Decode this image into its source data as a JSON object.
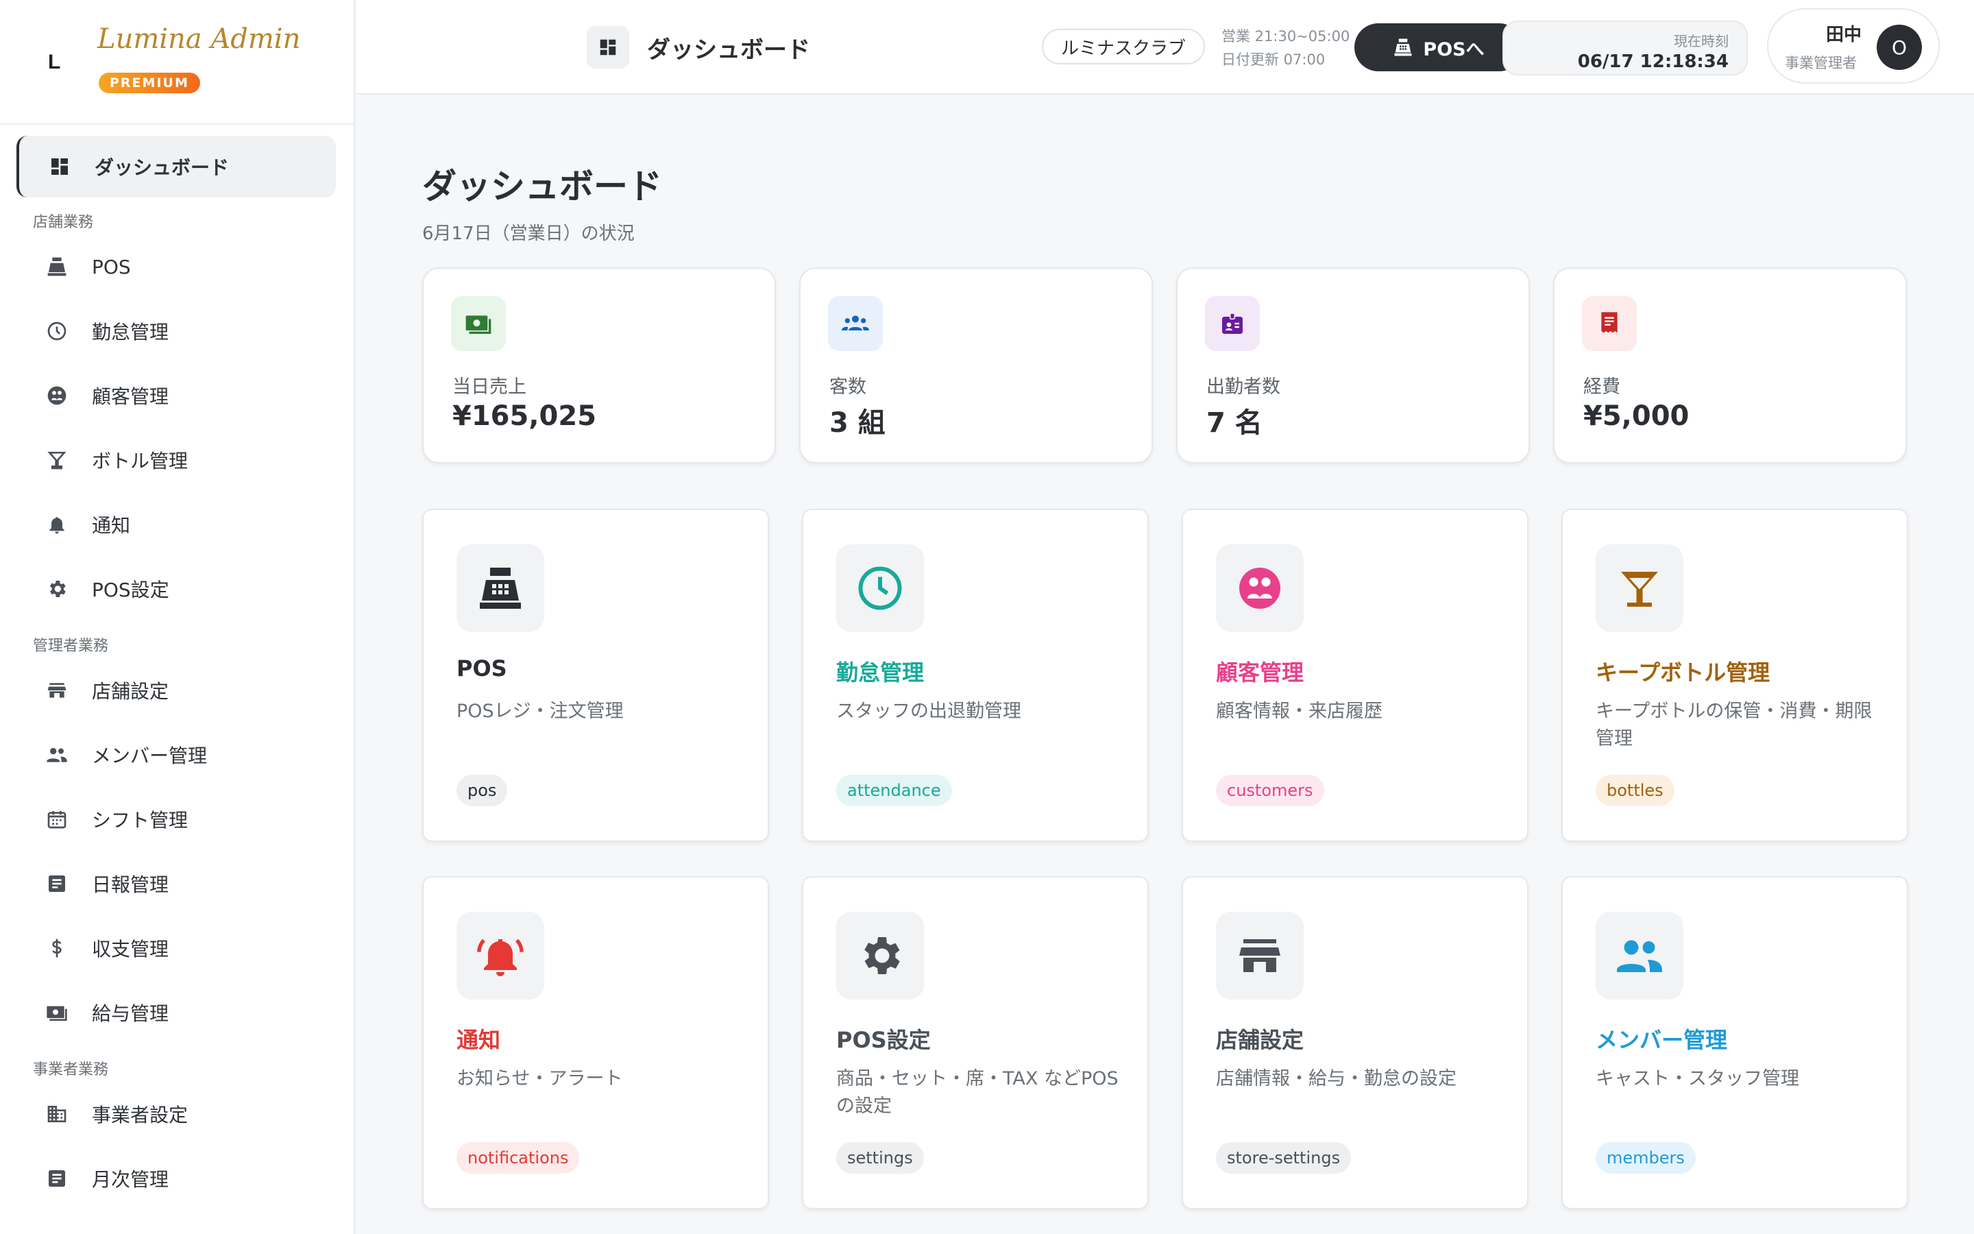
{
  "brand": {
    "mark": "L",
    "name": "Lumina Admin",
    "badge": "PREMIUM"
  },
  "sidebar": {
    "active": {
      "label": "ダッシュボード"
    },
    "sections": [
      {
        "title": "店舗業務",
        "items": [
          {
            "label": "POS"
          },
          {
            "label": "勤怠管理"
          },
          {
            "label": "顧客管理"
          },
          {
            "label": "ボトル管理"
          },
          {
            "label": "通知"
          },
          {
            "label": "POS設定"
          }
        ]
      },
      {
        "title": "管理者業務",
        "items": [
          {
            "label": "店舗設定"
          },
          {
            "label": "メンバー管理"
          },
          {
            "label": "シフト管理"
          },
          {
            "label": "日報管理"
          },
          {
            "label": "収支管理"
          },
          {
            "label": "給与管理"
          }
        ]
      },
      {
        "title": "事業者業務",
        "items": [
          {
            "label": "事業者設定"
          },
          {
            "label": "月次管理"
          }
        ]
      }
    ]
  },
  "topbar": {
    "title": "ダッシュボード",
    "store": "ルミナスクラブ",
    "hours": "営業 21:30~05:00",
    "date_update": "日付更新 07:00",
    "pos_button": "POSへ",
    "clock_label": "現在時刻",
    "clock_value": "06/17 12:18:34",
    "user_name": "田中",
    "user_role": "事業管理者",
    "avatar": "O"
  },
  "page": {
    "title": "ダッシュボード",
    "subtitle": "6月17日（営業日）の状況"
  },
  "stats": [
    {
      "label": "当日売上",
      "value": "¥165,025",
      "color": "#2e7d32",
      "bg": "#e8f5e9",
      "icon": "cash-icon"
    },
    {
      "label": "客数",
      "value": "3 組",
      "color": "#1565c0",
      "bg": "#e8f0fb",
      "icon": "group-icon"
    },
    {
      "label": "出勤者数",
      "value": "7 名",
      "color": "#6a1b9a",
      "bg": "#f3e8f8",
      "icon": "badge-icon"
    },
    {
      "label": "経費",
      "value": "¥5,000",
      "color": "#c62828",
      "bg": "#fdeaea",
      "icon": "receipt-icon"
    }
  ],
  "cards": [
    {
      "title": "POS",
      "desc": "POSレジ・注文管理",
      "tag": "pos",
      "color": "#2b2f33",
      "tag_bg": "#eeeff1",
      "tag_color": "#2b2f33",
      "icon": "register-icon"
    },
    {
      "title": "勤怠管理",
      "desc": "スタッフの出退勤管理",
      "tag": "attendance",
      "color": "#17a99a",
      "tag_bg": "#e3f6f3",
      "tag_color": "#17a99a",
      "icon": "clock-icon"
    },
    {
      "title": "顧客管理",
      "desc": "顧客情報・来店履歴",
      "tag": "customers",
      "color": "#e8408a",
      "tag_bg": "#fde8f1",
      "tag_color": "#e8408a",
      "icon": "customer-icon"
    },
    {
      "title": "キープボトル管理",
      "desc": "キープボトルの保管・消費・期限管理",
      "tag": "bottles",
      "color": "#a2620a",
      "tag_bg": "#fbf0e0",
      "tag_color": "#a2620a",
      "icon": "cocktail-icon"
    },
    {
      "title": "通知",
      "desc": "お知らせ・アラート",
      "tag": "notifications",
      "color": "#e53935",
      "tag_bg": "#fdeaea",
      "tag_color": "#e53935",
      "icon": "bell-icon"
    },
    {
      "title": "POS設定",
      "desc": "商品・セット・席・TAX などPOSの設定",
      "tag": "settings",
      "color": "#4a5056",
      "tag_bg": "#eeeff1",
      "tag_color": "#4a5056",
      "icon": "gear-icon"
    },
    {
      "title": "店舗設定",
      "desc": "店舗情報・給与・勤怠の設定",
      "tag": "store-settings",
      "color": "#4a5056",
      "tag_bg": "#eeeff1",
      "tag_color": "#4a5056",
      "icon": "store-icon"
    },
    {
      "title": "メンバー管理",
      "desc": "キャスト・スタッフ管理",
      "tag": "members",
      "color": "#1e9ad6",
      "tag_bg": "#e4f3fb",
      "tag_color": "#1e9ad6",
      "icon": "people-icon"
    }
  ]
}
